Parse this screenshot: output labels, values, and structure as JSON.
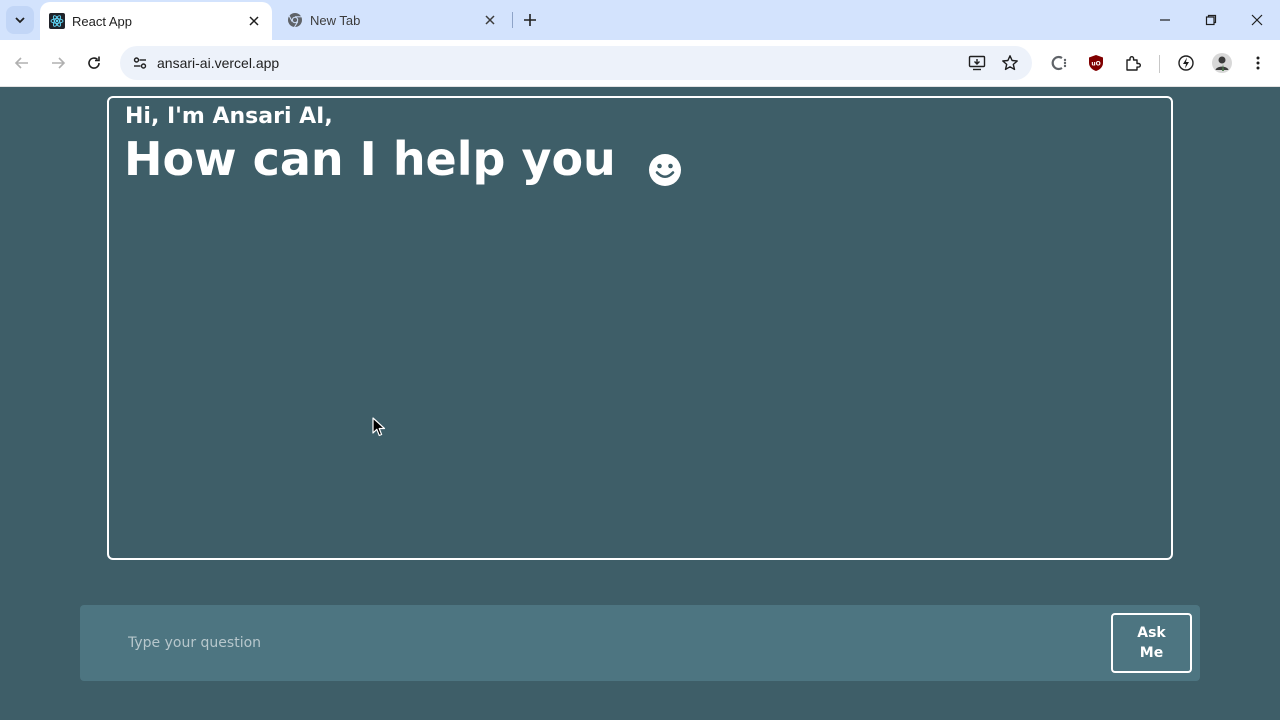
{
  "browser": {
    "tabs": [
      {
        "title": "React App",
        "active": true,
        "icon": "react-icon"
      },
      {
        "title": "New Tab",
        "active": false,
        "icon": "chrome-icon"
      }
    ],
    "url": "ansari-ai.vercel.app"
  },
  "chat": {
    "greeting_line1": "Hi, I'm Ansari AI,",
    "greeting_line2": "How can I help you",
    "emoji_icon": "smiley-face-icon"
  },
  "input": {
    "placeholder": "Type your question",
    "value": "",
    "ask_label": "Ask\nMe"
  },
  "colors": {
    "page_background": "#3e5e68",
    "input_bar": "#4d7581",
    "text": "#ffffff",
    "tabstrip": "#d3e3fd"
  }
}
